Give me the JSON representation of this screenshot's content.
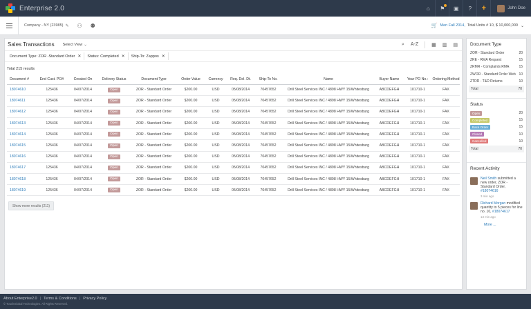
{
  "topbar": {
    "app_title": "Enterprise 2.0",
    "user_name": "John Doe",
    "icons": [
      "home-icon",
      "flag-icon",
      "clipboard-icon",
      "help-icon",
      "plus-icon"
    ]
  },
  "toolbar": {
    "company": "Company - NY (23985)",
    "season": "Men Fall 2014,",
    "units": "Total Units # 10, $ 10,000,000"
  },
  "main": {
    "title": "Sales Transactions",
    "select_view": "Select View",
    "filters": [
      {
        "label": "Document Type:",
        "value": "ZOR -Standard Order"
      },
      {
        "label": "Status:",
        "value": "Completed"
      },
      {
        "label": "Ship-To:",
        "value": "Zappos"
      }
    ],
    "total": "Total 215 results",
    "sort_label": "A-Z",
    "columns": [
      "Document #",
      "End Cust. PO#",
      "Created On",
      "Delivery Status",
      "Document Type",
      "Order Value",
      "Currency",
      "Req. Del. Dt.",
      "Ship-To No.",
      "Name",
      "Buyer Name",
      "Your PO No.:",
      "Ordering Method"
    ],
    "rows": [
      {
        "doc": "18074610",
        "po": "125436",
        "created": "04/07/2014",
        "status": "Open",
        "type": "ZOR - Standard Order",
        "value": "$200.00",
        "currency": "USD",
        "req": "05/08/2014",
        "shipto": "70457652",
        "name": "Drill Steel Services INC / 4898 HWY 15/Whitesburg",
        "buyer": "ABCDEFGH",
        "yourpo": "101710-1",
        "method": "FAX"
      },
      {
        "doc": "18074611",
        "po": "125436",
        "created": "04/07/2014",
        "status": "Open",
        "type": "ZOR - Standard Order",
        "value": "$200.00",
        "currency": "USD",
        "req": "05/08/2014",
        "shipto": "70457652",
        "name": "Drill Steel Services INC / 4898 HWY 15/Whitesburg",
        "buyer": "ABCDEFGH",
        "yourpo": "101710-1",
        "method": "FAX"
      },
      {
        "doc": "18074612",
        "po": "125436",
        "created": "04/07/2014",
        "status": "Open",
        "type": "ZOR - Standard Order",
        "value": "$200.00",
        "currency": "USD",
        "req": "05/08/2014",
        "shipto": "70457652",
        "name": "Drill Steel Services INC / 4898 HWY 15/Whitesburg",
        "buyer": "ABCDEFGH",
        "yourpo": "101710-1",
        "method": "FAX"
      },
      {
        "doc": "18074613",
        "po": "125436",
        "created": "04/07/2014",
        "status": "Open",
        "type": "ZOR - Standard Order",
        "value": "$200.00",
        "currency": "USD",
        "req": "05/08/2014",
        "shipto": "70457652",
        "name": "Drill Steel Services INC / 4898 HWY 15/Whitesburg",
        "buyer": "ABCDEFGH",
        "yourpo": "101710-1",
        "method": "FAX"
      },
      {
        "doc": "18074614",
        "po": "125436",
        "created": "04/07/2014",
        "status": "Open",
        "type": "ZOR - Standard Order",
        "value": "$200.00",
        "currency": "USD",
        "req": "05/08/2014",
        "shipto": "70457652",
        "name": "Drill Steel Services INC / 4898 HWY 15/Whitesburg",
        "buyer": "ABCDEFGH",
        "yourpo": "101710-1",
        "method": "FAX"
      },
      {
        "doc": "18074615",
        "po": "125436",
        "created": "04/07/2014",
        "status": "Open",
        "type": "ZOR - Standard Order",
        "value": "$200.00",
        "currency": "USD",
        "req": "05/08/2014",
        "shipto": "70457652",
        "name": "Drill Steel Services INC / 4898 HWY 15/Whitesburg",
        "buyer": "ABCDEFGH",
        "yourpo": "101710-1",
        "method": "FAX"
      },
      {
        "doc": "18074616",
        "po": "125436",
        "created": "04/07/2014",
        "status": "Open",
        "type": "ZOR - Standard Order",
        "value": "$200.00",
        "currency": "USD",
        "req": "05/08/2014",
        "shipto": "70457652",
        "name": "Drill Steel Services INC / 4898 HWY 15/Whitesburg",
        "buyer": "ABCDEFGH",
        "yourpo": "101710-1",
        "method": "FAX"
      },
      {
        "doc": "18074617",
        "po": "125436",
        "created": "04/07/2014",
        "status": "Open",
        "type": "ZOR - Standard Order",
        "value": "$200.00",
        "currency": "USD",
        "req": "05/08/2014",
        "shipto": "70457652",
        "name": "Drill Steel Services INC / 4898 HWY 15/Whitesburg",
        "buyer": "ABCDEFGH",
        "yourpo": "101710-1",
        "method": "FAX"
      },
      {
        "doc": "18074618",
        "po": "125436",
        "created": "04/07/2014",
        "status": "Open",
        "type": "ZOR - Standard Order",
        "value": "$200.00",
        "currency": "USD",
        "req": "05/08/2014",
        "shipto": "70457652",
        "name": "Drill Steel Services INC / 4898 HWY 15/Whitesburg",
        "buyer": "ABCDEFGH",
        "yourpo": "101710-1",
        "method": "FAX"
      },
      {
        "doc": "18074619",
        "po": "125436",
        "created": "04/07/2014",
        "status": "Open",
        "type": "ZOR - Standard Order",
        "value": "$200.00",
        "currency": "USD",
        "req": "05/08/2014",
        "shipto": "70457652",
        "name": "Drill Steel Services INC / 4898 HWY 15/Whitesburg",
        "buyer": "ABCDEFGH",
        "yourpo": "101710-1",
        "method": "FAX"
      }
    ],
    "show_more": "Show more results (211)"
  },
  "side": {
    "doc_type_title": "Document Type",
    "doc_types": [
      {
        "label": "ZOR - Standard Order",
        "count": "20"
      },
      {
        "label": "ZRE - RMA Request",
        "count": "15"
      },
      {
        "label": "ZRMR - Complaints RMA",
        "count": "15"
      },
      {
        "label": "ZWOR - Standard Order Web",
        "count": "10"
      },
      {
        "label": "ZTDR - T&D Returns",
        "count": "10"
      }
    ],
    "doc_total": {
      "label": "Total",
      "count": "70"
    },
    "status_title": "Status",
    "statuses": [
      {
        "label": "Open",
        "count": "20",
        "color": "#c39a9a"
      },
      {
        "label": "Completed",
        "count": "15",
        "color": "#c6c96a"
      },
      {
        "label": "Back Order",
        "count": "15",
        "color": "#6aaed6"
      },
      {
        "label": "Closed",
        "count": "10",
        "color": "#b57ab5"
      },
      {
        "label": "Cancelled",
        "count": "10",
        "color": "#e07a7a"
      }
    ],
    "status_total": {
      "label": "Total",
      "count": "70"
    },
    "activity_title": "Recent Activity",
    "activities": [
      {
        "who": "Neil Smith",
        "text": " submitted a new order, ZOR - Standard Order, ",
        "link": "#18074616",
        "time": "3 min ago"
      },
      {
        "who": "Richard Morgan",
        "text": " modified quantity to 5 pieces for line no. 10, ",
        "link": "#18074617",
        "time": "13 min ago"
      }
    ],
    "more": "More ..."
  },
  "footer": {
    "links": [
      "About Enterprise2.0",
      "Terms & Conditions",
      "Privacy Policy"
    ],
    "copyright": "© TouchGlobal Technologies. All Rights Reserved."
  }
}
